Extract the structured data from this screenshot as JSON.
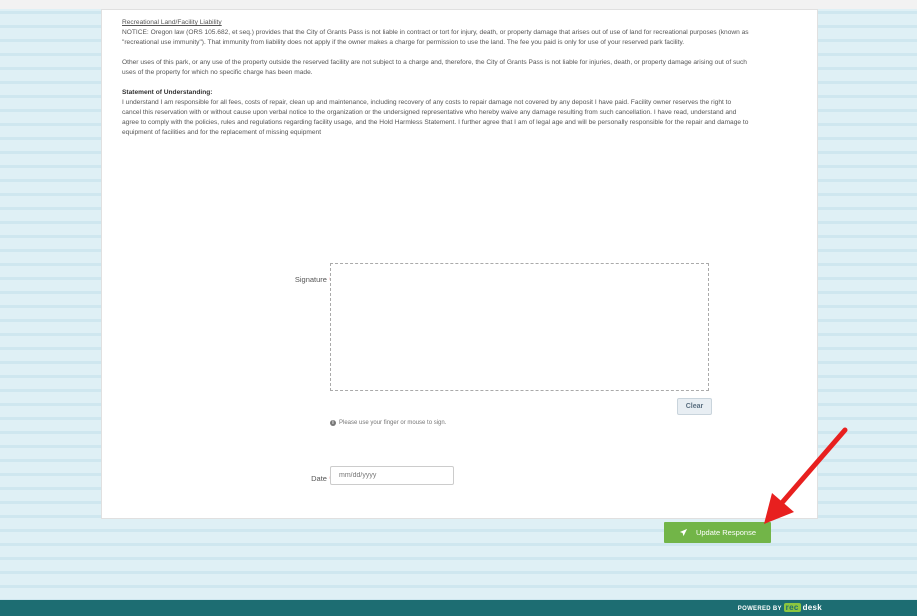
{
  "legal": {
    "rec_heading": "Recreational Land/Facility Liability",
    "rec_text": "NOTICE: Oregon law (ORS 105.682, et seq.) provides that the City of Grants Pass is not liable in contract or tort for injury, death, or property damage that arises out of use of land for recreational purposes (known as \"recreational use immunity\"). That immunity from liability does not apply if the owner makes a charge for permission to use the land. The fee you paid is only for use of your reserved park facility.",
    "other_text": "Other uses of this park, or any use of the property outside the reserved facility are not subject to a charge and, therefore, the City of Grants Pass is not liable for injuries, death, or property damage arising out of such uses of the property for which no specific charge has been made.",
    "sou_heading": "Statement of Understanding:",
    "sou_text": "I understand I am responsible for all fees, costs of repair, clean up and maintenance, including recovery of any costs to repair damage not covered by any deposit I have paid. Facility owner reserves the right to cancel this reservation with or without cause upon verbal notice to the organization or the undersigned representative who hereby waive any damage resulting from such cancellation. I have read, understand and agree to comply with the policies, rules and regulations regarding facility usage, and the Hold Harmless Statement. I further agree that I am of legal age and will be personally responsible for the repair and damage to equipment of facilities and for the replacement of missing equipment"
  },
  "form": {
    "signature_label": "Signature",
    "required_mark": "*",
    "clear_label": "Clear",
    "hint_text": "Please use your finger or mouse to sign.",
    "date_label": "Date",
    "date_placeholder": "mm/dd/yyyy",
    "update_label": "Update Response"
  },
  "footer": {
    "powered_by": "POWERED BY",
    "brand_rec": "rec",
    "brand_desk": "desk"
  },
  "colors": {
    "accent_green": "#72b548",
    "footer_teal": "#1d6d72",
    "annotation_arrow": "#e8201f"
  },
  "icons": {
    "send": "paper-plane-icon",
    "info": "info-circle-icon",
    "annotation": "red-arrow-icon"
  }
}
